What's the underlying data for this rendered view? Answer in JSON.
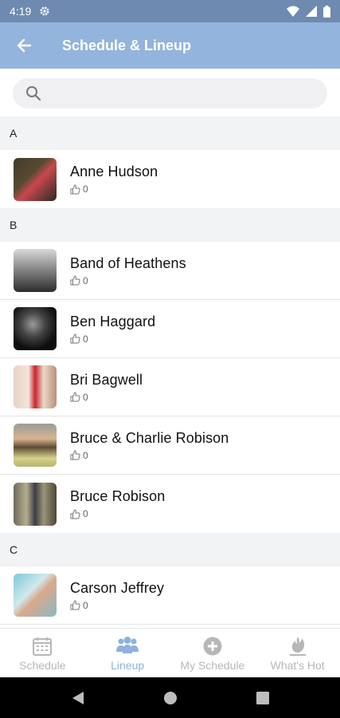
{
  "status_bar": {
    "time": "4:19"
  },
  "app_bar": {
    "title": "Schedule & Lineup"
  },
  "search": {
    "placeholder": ""
  },
  "sections": [
    {
      "letter": "A",
      "artists": [
        {
          "name": "Anne Hudson",
          "likes": "0"
        }
      ]
    },
    {
      "letter": "B",
      "artists": [
        {
          "name": "Band of Heathens",
          "likes": "0"
        },
        {
          "name": "Ben Haggard",
          "likes": "0"
        },
        {
          "name": "Bri Bagwell",
          "likes": "0"
        },
        {
          "name": "Bruce & Charlie Robison",
          "likes": "0"
        },
        {
          "name": "Bruce Robison",
          "likes": "0"
        }
      ]
    },
    {
      "letter": "C",
      "artists": [
        {
          "name": "Carson Jeffrey",
          "likes": "0"
        }
      ]
    }
  ],
  "tabs": [
    {
      "label": "Schedule",
      "icon": "calendar-icon"
    },
    {
      "label": "Lineup",
      "icon": "people-icon"
    },
    {
      "label": "My Schedule",
      "icon": "plus-circle-icon"
    },
    {
      "label": "What's Hot",
      "icon": "flame-icon"
    }
  ],
  "active_tab": "Lineup",
  "colors": {
    "app_bar": "#93b4dc",
    "status_bar": "#6e8ab0",
    "active_tab": "#8fb1db",
    "inactive_tab": "#b7b7b7"
  }
}
